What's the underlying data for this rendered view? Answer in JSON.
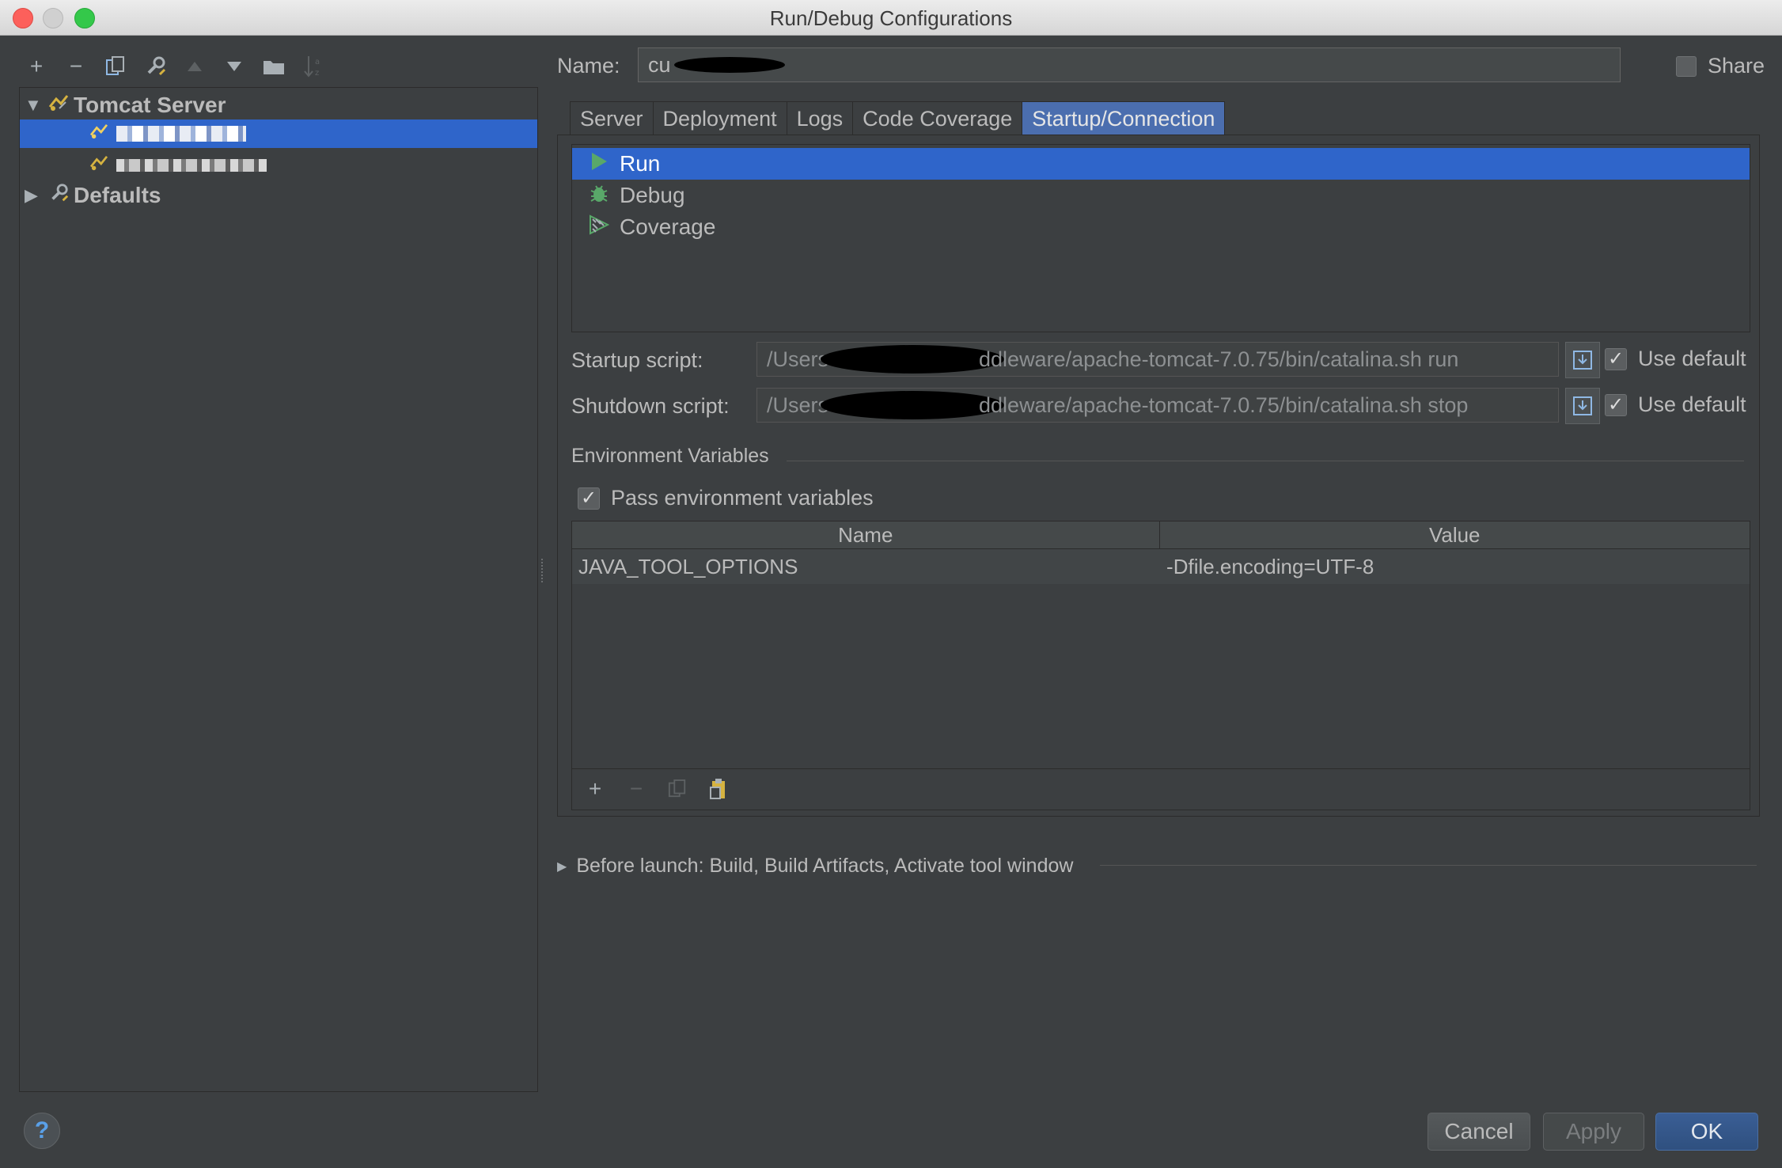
{
  "window": {
    "title": "Run/Debug Configurations"
  },
  "colors": {
    "accent": "#2f65ca",
    "tab_active": "#4b6eaf",
    "background": "#3c3f41",
    "ok_button": "#2f507f"
  },
  "left_toolbar": {
    "icons": [
      "add-icon",
      "remove-icon",
      "copy-icon",
      "wrench-icon",
      "arrow-up-icon",
      "arrow-down-icon",
      "folder-icon",
      "sort-icon"
    ]
  },
  "tree": {
    "group_label": "Tomcat Server",
    "defaults_label": "Defaults"
  },
  "config": {
    "name_label": "Name:",
    "name_value": "cu",
    "share_label": "Share"
  },
  "tabs": [
    "Server",
    "Deployment",
    "Logs",
    "Code Coverage",
    "Startup/Connection"
  ],
  "modes": [
    "Run",
    "Debug",
    "Coverage"
  ],
  "startup": {
    "label": "Startup script:",
    "prefix": "/Users",
    "suffix": "ddleware/apache-tomcat-7.0.75/bin/catalina.sh run",
    "use_default": "Use default"
  },
  "shutdown": {
    "label": "Shutdown script:",
    "prefix": "/Users",
    "suffix": "ddleware/apache-tomcat-7.0.75/bin/catalina.sh stop",
    "use_default": "Use default"
  },
  "env": {
    "section_title": "Environment Variables",
    "pass_label": "Pass environment variables",
    "columns": [
      "Name",
      "Value"
    ],
    "rows": [
      {
        "name": "JAVA_TOOL_OPTIONS",
        "value": "-Dfile.encoding=UTF-8"
      }
    ]
  },
  "before_launch": "Before launch: Build, Build Artifacts, Activate tool window",
  "buttons": {
    "help": "?",
    "cancel": "Cancel",
    "apply": "Apply",
    "ok": "OK"
  }
}
